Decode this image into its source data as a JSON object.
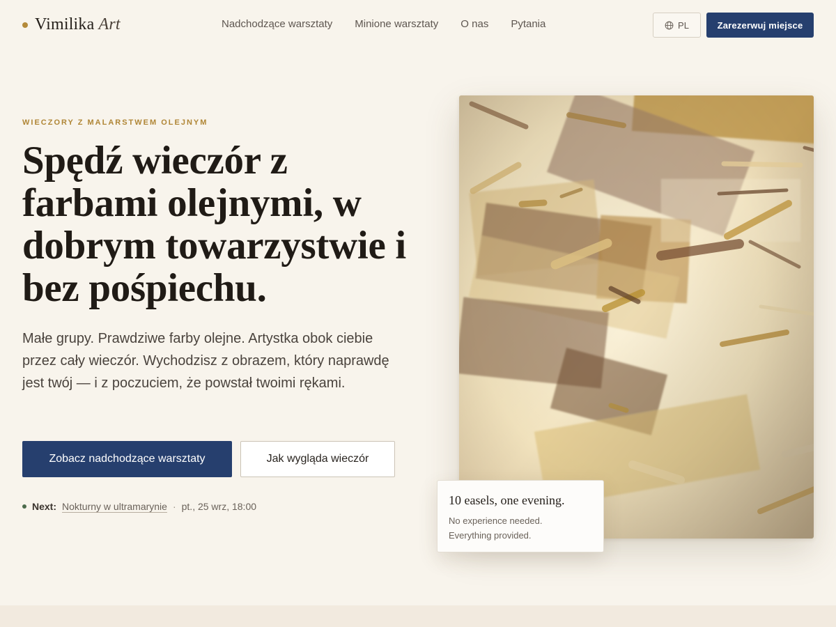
{
  "brand": {
    "name": "Vimilika",
    "accent": "Art",
    "dot_color": "#b48a3a"
  },
  "nav": [
    {
      "label": "Nadchodzące warsztaty"
    },
    {
      "label": "Minione warsztaty"
    },
    {
      "label": "O nas"
    },
    {
      "label": "Pytania"
    }
  ],
  "header": {
    "language": {
      "label": "PL",
      "icon": "globe-icon"
    },
    "reserve_label": "Zarezerwuj miejsce"
  },
  "hero": {
    "eyebrow": "WIECZORY Z MALARSTWEM OLEJNYM",
    "headline": "Spędź wieczór z farbami olejnymi, w dobrym towarzystwie i bez pośpiechu.",
    "lead": "Małe grupy. Prawdziwe farby olejne. Artystka obok ciebie przez cały wieczór. Wychodzisz z obrazem, który naprawdę jest twój — i z poczuciem, że powstał twoimi rękami.",
    "primary_cta": "Zobacz nadchodzące warsztaty",
    "secondary_cta": "Jak wygląda wieczór",
    "next": {
      "label": "Next:",
      "title": "Nokturny w ultramarynie",
      "separator": "·",
      "date": "pt., 25 wrz, 18:00"
    }
  },
  "caption": {
    "title": "10 easels, one evening.",
    "line1": "No experience needed.",
    "line2": "Everything provided."
  },
  "colors": {
    "accent_blue": "#263f6e",
    "eyebrow_gold": "#b08636",
    "background": "#f8f4ec"
  }
}
